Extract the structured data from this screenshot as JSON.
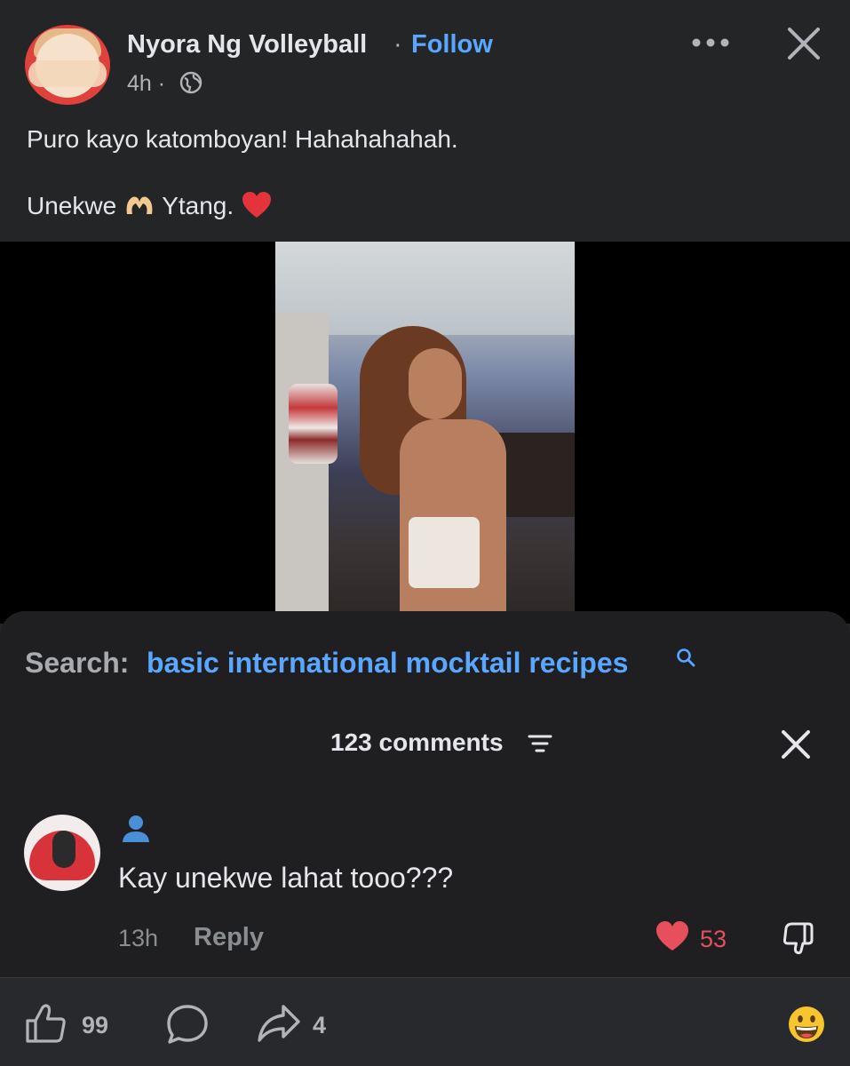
{
  "post": {
    "author": "Nyora Ng Volleyball",
    "separator": "·",
    "follow_label": "Follow",
    "time": "4h ·",
    "text_line_1": "Puro kayo katomboyan! Hahahahahah.",
    "text_line_2_before": "Unekwe ",
    "text_line_2_after": " Ytang. "
  },
  "search": {
    "prefix": "Search:",
    "query": "basic international mocktail recipes"
  },
  "comments": {
    "count_label": "123 comments",
    "items": [
      {
        "text": "Kay unekwe lahat tooo???",
        "time": "13h",
        "reply_label": "Reply",
        "likes": "53"
      }
    ]
  },
  "actions": {
    "reactions": "99",
    "shares": "4"
  },
  "colors": {
    "accent": "#5aa7ff",
    "like": "#e5505c",
    "background": "#242526"
  },
  "icons": [
    "globe-icon",
    "more-icon",
    "close-icon",
    "search-icon",
    "sort-icon",
    "user-icon",
    "heart-icon",
    "dislike-icon",
    "thumbs-up-icon",
    "comment-icon",
    "share-icon",
    "grinning-emoji-icon"
  ]
}
